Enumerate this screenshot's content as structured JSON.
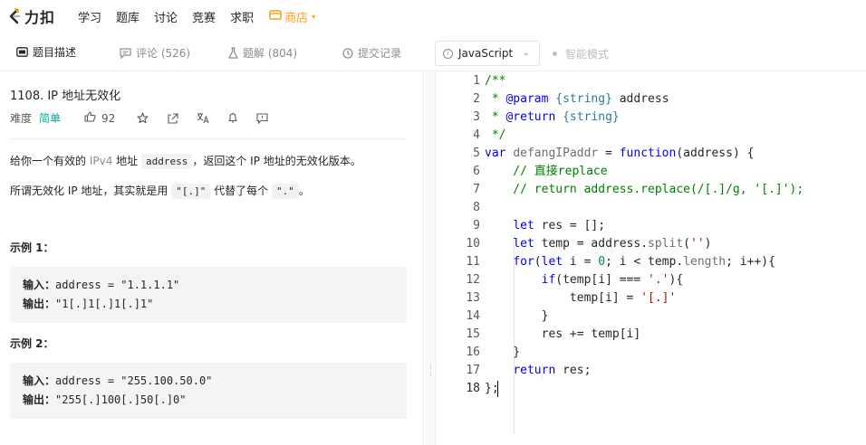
{
  "nav": {
    "logo_text": "力扣",
    "items": [
      "学习",
      "题库",
      "讨论",
      "竞赛",
      "求职"
    ],
    "store": "商店"
  },
  "tabs": {
    "description": "题目描述",
    "comments": "评论 (526)",
    "solutions": "题解 (804)",
    "submissions": "提交记录"
  },
  "editor_bar": {
    "language": "JavaScript",
    "smart_mode": "智能模式"
  },
  "problem": {
    "title": "1108. IP 地址无效化",
    "difficulty_label": "难度",
    "difficulty": "简单",
    "likes": "92",
    "desc1_pre": "给你一个有效的 ",
    "desc1_ipv4": "IPv4",
    "desc1_mid": " 地址 ",
    "desc1_code": "address",
    "desc1_post": "，返回这个 IP 地址的无效化版本。",
    "desc2_pre": "所谓无效化 IP 地址，其实就是用 ",
    "desc2_code1": "\"[.]\"",
    "desc2_mid": " 代替了每个 ",
    "desc2_code2": "\".\"",
    "desc2_post": "。",
    "examples": [
      {
        "title": "示例 1：",
        "input_label": "输入：",
        "input": "address = \"1.1.1.1\"",
        "output_label": "输出：",
        "output": "\"1[.]1[.]1[.]1\""
      },
      {
        "title": "示例 2：",
        "input_label": "输入：",
        "input": "address = \"255.100.50.0\"",
        "output_label": "输出：",
        "output": "\"255[.]100[.]50[.]0\""
      }
    ]
  },
  "code": {
    "line_numbers": [
      "1",
      "2",
      "3",
      "4",
      "5",
      "6",
      "7",
      "8",
      "9",
      "10",
      "11",
      "12",
      "13",
      "14",
      "15",
      "16",
      "17",
      "18"
    ],
    "active_line": "18",
    "lines": [
      [
        {
          "t": "/**",
          "c": "cm"
        }
      ],
      [
        {
          "t": " * ",
          "c": "cm"
        },
        {
          "t": "@param",
          "c": "kw"
        },
        {
          "t": " ",
          "c": "cm"
        },
        {
          "t": "{string}",
          "c": "ty"
        },
        {
          "t": " address",
          "c": ""
        }
      ],
      [
        {
          "t": " * ",
          "c": "cm"
        },
        {
          "t": "@return",
          "c": "kw"
        },
        {
          "t": " ",
          "c": "cm"
        },
        {
          "t": "{string}",
          "c": "ty"
        }
      ],
      [
        {
          "t": " */",
          "c": "cm"
        }
      ],
      [
        {
          "t": "var",
          "c": "kw"
        },
        {
          "t": " ",
          "c": ""
        },
        {
          "t": "defangIPaddr",
          "c": "gr"
        },
        {
          "t": " = ",
          "c": ""
        },
        {
          "t": "function",
          "c": "kw"
        },
        {
          "t": "(address) {",
          "c": ""
        }
      ],
      [
        {
          "t": "    // 直接replace",
          "c": "cm"
        }
      ],
      [
        {
          "t": "    // return address.replace(/[.]/g, '[.]');",
          "c": "cm"
        }
      ],
      [
        {
          "t": "",
          "c": ""
        }
      ],
      [
        {
          "t": "    ",
          "c": ""
        },
        {
          "t": "let",
          "c": "kw"
        },
        {
          "t": " res = [];",
          "c": ""
        }
      ],
      [
        {
          "t": "    ",
          "c": ""
        },
        {
          "t": "let",
          "c": "kw"
        },
        {
          "t": " temp = address.",
          "c": ""
        },
        {
          "t": "split",
          "c": "gr"
        },
        {
          "t": "(",
          "c": ""
        },
        {
          "t": "''",
          "c": "st"
        },
        {
          "t": ")",
          "c": ""
        }
      ],
      [
        {
          "t": "    ",
          "c": ""
        },
        {
          "t": "for",
          "c": "kw"
        },
        {
          "t": "(",
          "c": ""
        },
        {
          "t": "let",
          "c": "kw"
        },
        {
          "t": " i = ",
          "c": ""
        },
        {
          "t": "0",
          "c": "nm"
        },
        {
          "t": "; i < temp.",
          "c": ""
        },
        {
          "t": "length",
          "c": "gr"
        },
        {
          "t": "; i++){",
          "c": ""
        }
      ],
      [
        {
          "t": "        ",
          "c": ""
        },
        {
          "t": "if",
          "c": "kw"
        },
        {
          "t": "(temp[i] === ",
          "c": ""
        },
        {
          "t": "'.'",
          "c": "st"
        },
        {
          "t": "){",
          "c": ""
        }
      ],
      [
        {
          "t": "            temp[i] = ",
          "c": ""
        },
        {
          "t": "'[.]'",
          "c": "st"
        }
      ],
      [
        {
          "t": "        }",
          "c": ""
        }
      ],
      [
        {
          "t": "        res += temp[i]",
          "c": ""
        }
      ],
      [
        {
          "t": "    }",
          "c": ""
        }
      ],
      [
        {
          "t": "    ",
          "c": ""
        },
        {
          "t": "return",
          "c": "kw"
        },
        {
          "t": " res;",
          "c": ""
        }
      ],
      [
        {
          "t": "};",
          "c": ""
        }
      ]
    ]
  }
}
